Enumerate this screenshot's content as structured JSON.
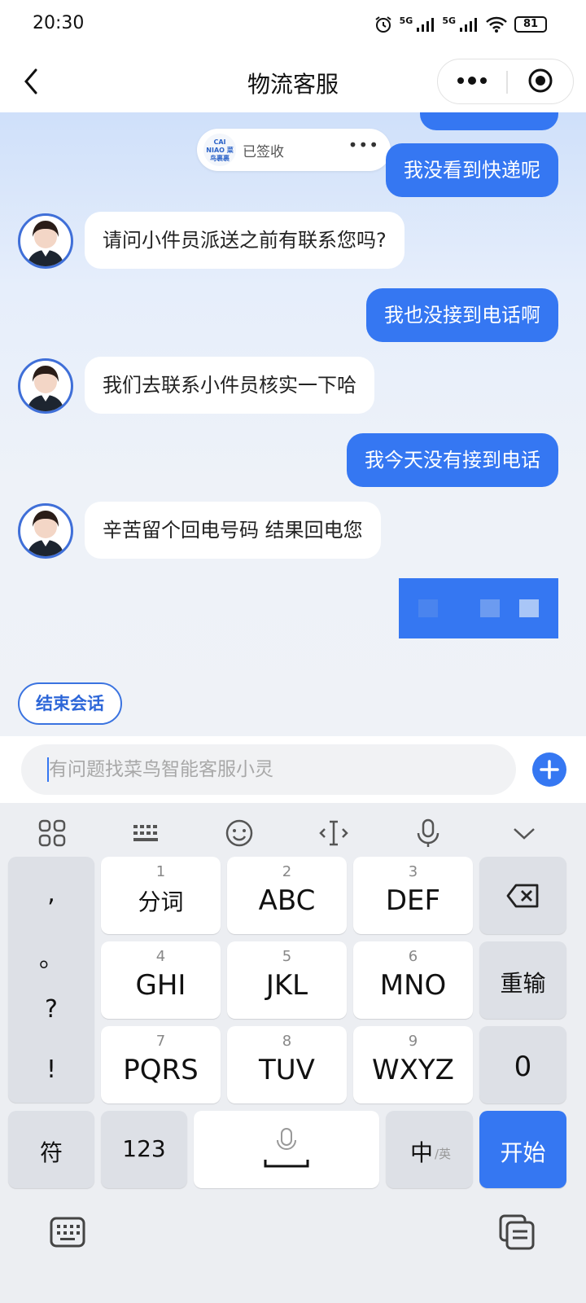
{
  "status": {
    "time": "20:30",
    "net1": "5G",
    "net2": "5G",
    "battery": "81"
  },
  "nav": {
    "title": "物流客服"
  },
  "card": {
    "logo": "CAI NIAO 菜鸟裹裹",
    "status": "已签收"
  },
  "messages": [
    {
      "side": "out",
      "text": "我没看到快递呢"
    },
    {
      "side": "in",
      "text": "请问小件员派送之前有联系您吗?"
    },
    {
      "side": "out",
      "text": "我也没接到电话啊"
    },
    {
      "side": "in",
      "text": "我们去联系小件员核实一下哈"
    },
    {
      "side": "out",
      "text": "我今天没有接到电话"
    },
    {
      "side": "in",
      "text": "辛苦留个回电号码 结果回电您"
    }
  ],
  "end_button": "结束会话",
  "input": {
    "placeholder": "有问题找菜鸟智能客服小灵"
  },
  "keyboard": {
    "toolbar": [
      "apps-icon",
      "keyboard-layout-icon",
      "emoji-icon",
      "cursor-icon",
      "microphone-icon",
      "collapse-icon"
    ],
    "punct": [
      ",",
      "。",
      "?",
      "!"
    ],
    "keys": [
      {
        "num": "1",
        "label": "分词"
      },
      {
        "num": "2",
        "label": "ABC"
      },
      {
        "num": "3",
        "label": "DEF"
      },
      {
        "num": "4",
        "label": "GHI"
      },
      {
        "num": "5",
        "label": "JKL"
      },
      {
        "num": "6",
        "label": "MNO"
      },
      {
        "num": "7",
        "label": "PQRS"
      },
      {
        "num": "8",
        "label": "TUV"
      },
      {
        "num": "9",
        "label": "WXYZ"
      }
    ],
    "reinput": "重输",
    "zero": "0",
    "symbol": "符",
    "numbers": "123",
    "lang_main": "中",
    "lang_sub": "/英",
    "go": "开始"
  },
  "colors": {
    "accent": "#3577f2",
    "keyboard_bg": "#eceef2"
  }
}
